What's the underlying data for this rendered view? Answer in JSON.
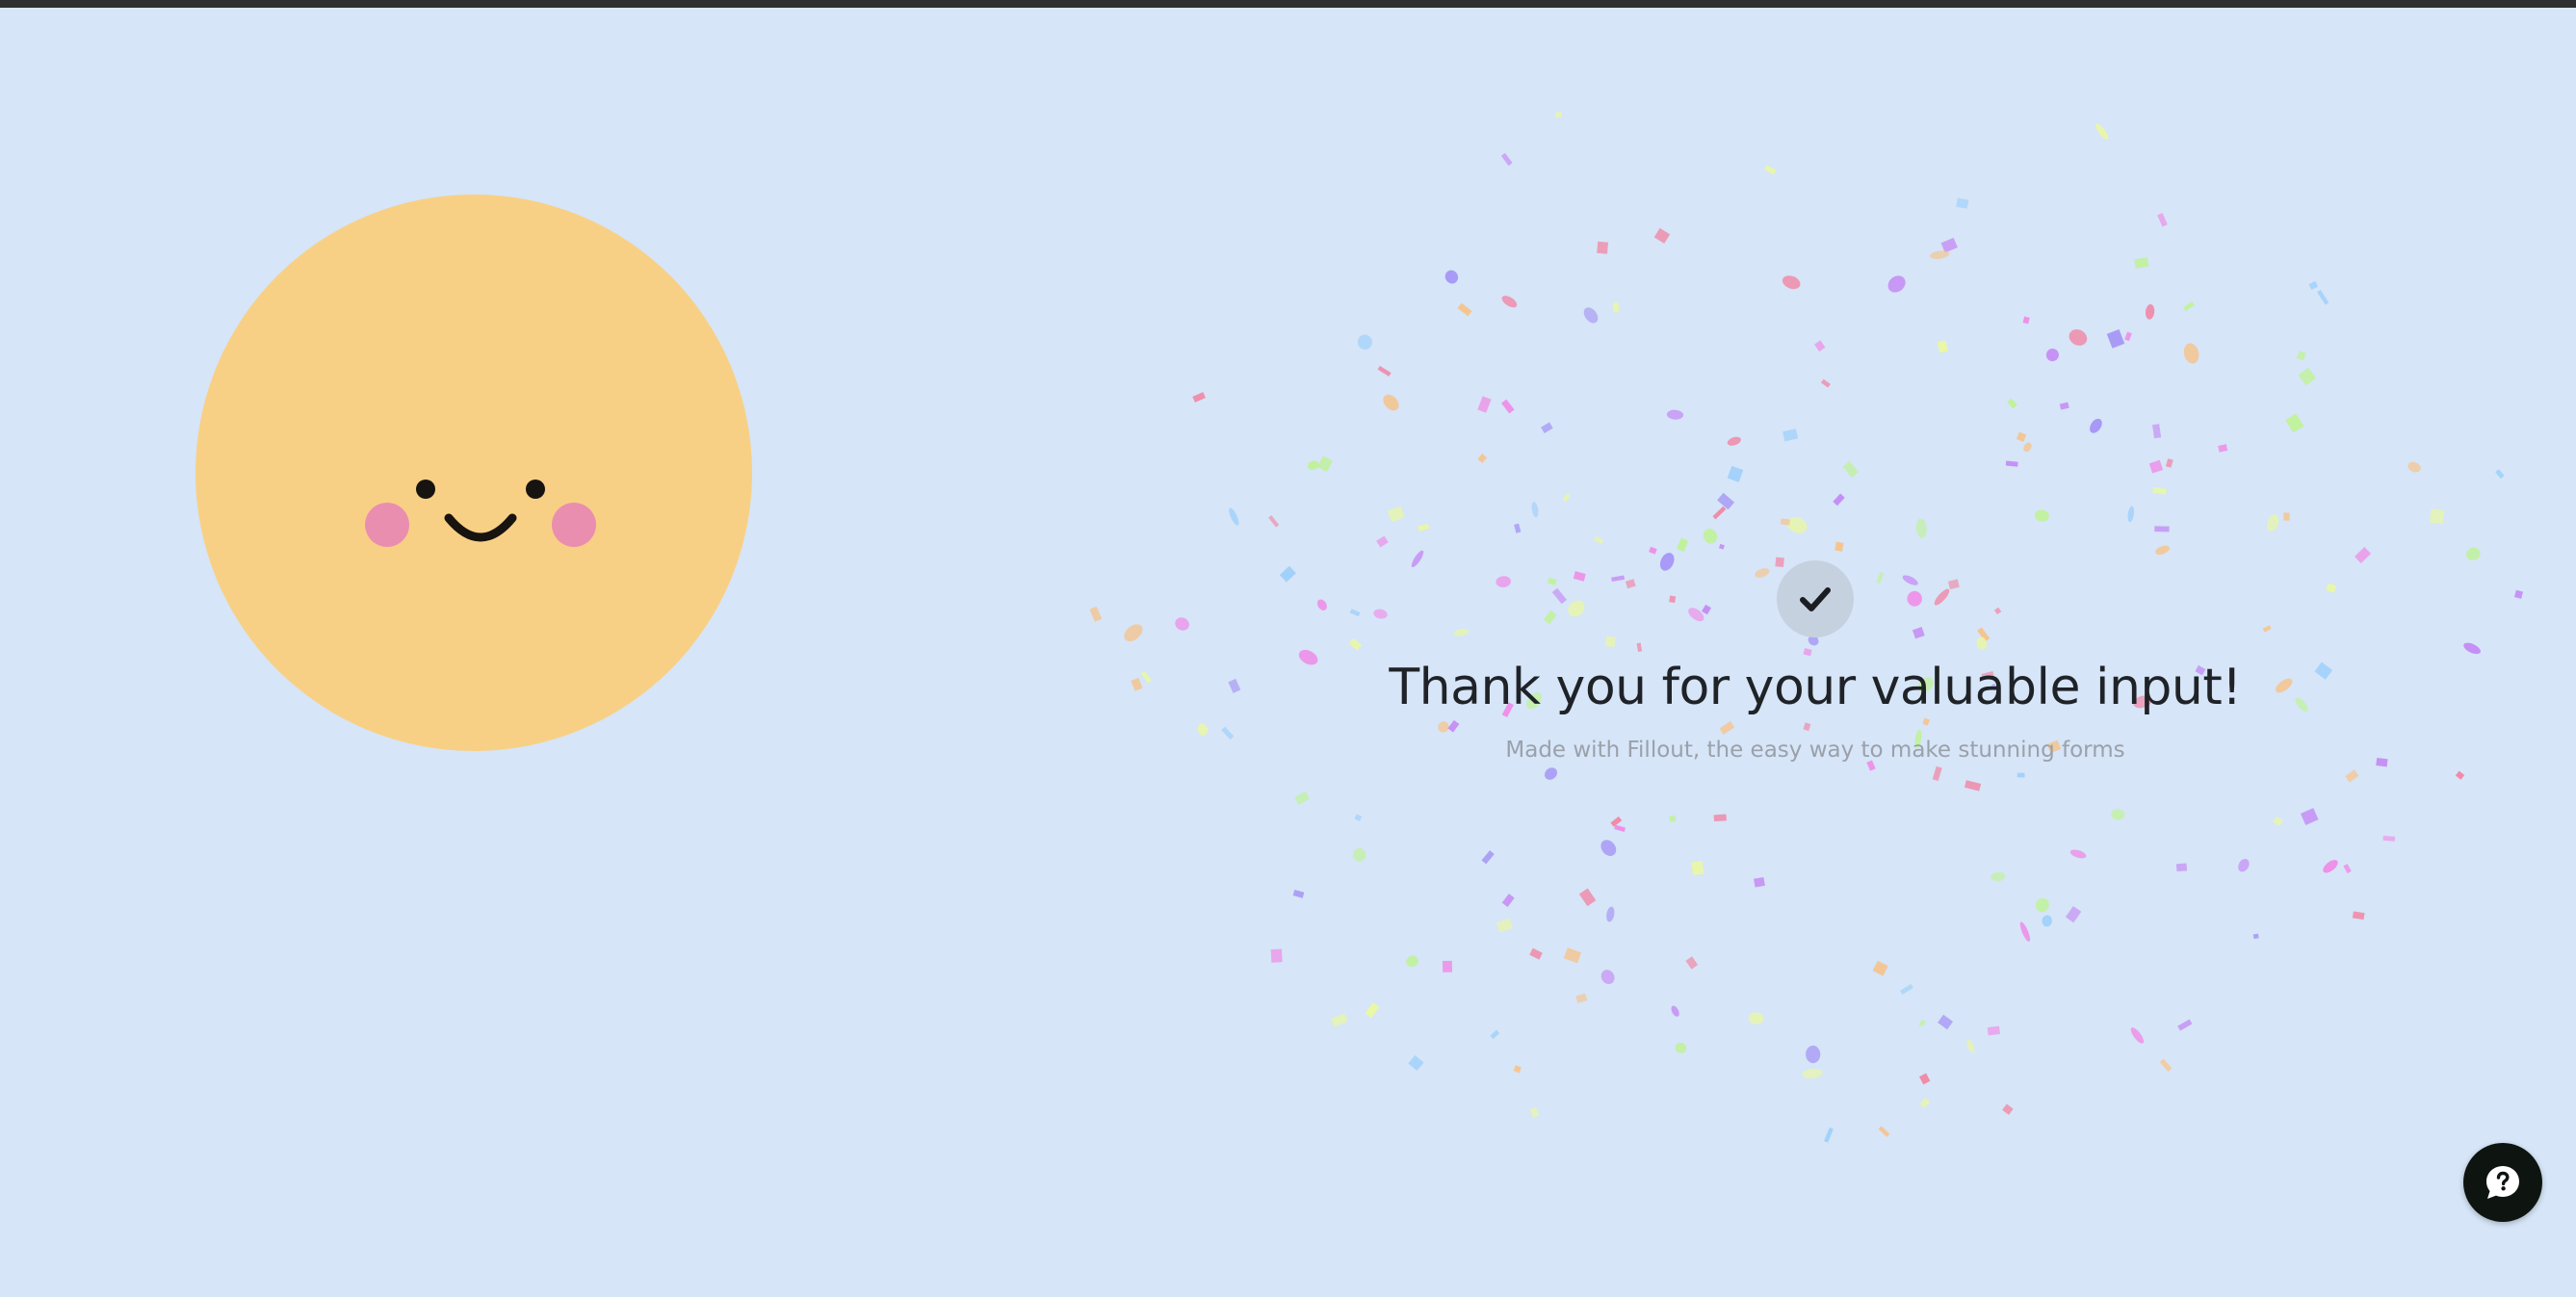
{
  "page": {
    "background_color": "#d6e5f7",
    "top_bar_color": "#2e2f31"
  },
  "illustration": {
    "icon": "smiley-sun",
    "face_color": "#f8d085",
    "cheek_color": "#ea8eb0",
    "feature_color": "#171310"
  },
  "confirmation": {
    "icon": "check-icon",
    "badge_color": "#c6d1e0",
    "title": "Thank you for your valuable input!",
    "subtitle": "Made with Fillout, the easy way to make stunning forms"
  },
  "help_widget": {
    "icon": "chat-question-icon",
    "color": "#0e1410"
  },
  "confetti": {
    "colors": [
      "#f08aa8",
      "#c58bf5",
      "#9fd0fb",
      "#f5c48e",
      "#e9f7a5",
      "#bff29a",
      "#ee8fe8",
      "#a596f5"
    ]
  }
}
